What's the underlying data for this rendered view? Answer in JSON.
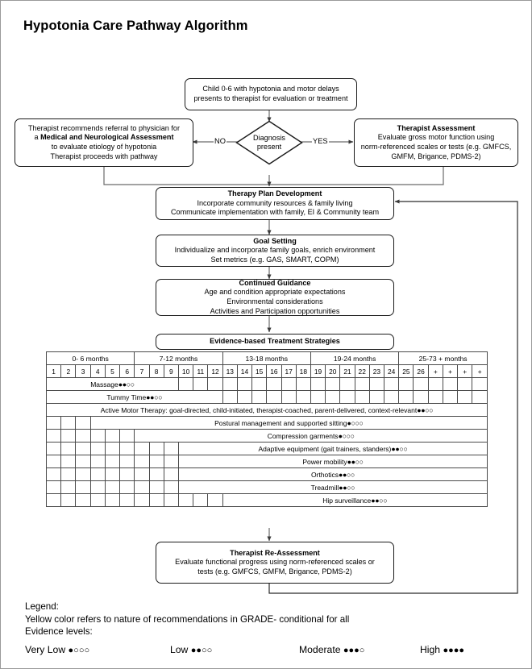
{
  "page": {
    "title": "Hypotonia Care Pathway Algorithm"
  },
  "flow": {
    "start": {
      "name": "start-box",
      "lines": [
        "Child 0-6 with hypotonia and motor delays",
        "presents to therapist for evaluation or treatment"
      ]
    },
    "decision": {
      "name": "decision-diamond",
      "lines": [
        "Diagnosis",
        "present"
      ],
      "no_label": "NO",
      "yes_label": "YES"
    },
    "left_box": {
      "name": "referral-box",
      "line1": "Therapist recommends referral to physician for",
      "line2_pre": "a ",
      "line2_bold": "Medical and Neurological Assessment",
      "line3": "to evaluate etiology of hypotonia",
      "line4": "Therapist proceeds with pathway"
    },
    "right_box": {
      "name": "therapist-assessment-box",
      "heading": "Therapist Assessment",
      "lines": [
        "Evaluate gross motor function using",
        "norm-referenced scales or tests (e.g. GMFCS,",
        "GMFM, Brigance, PDMS-2)"
      ]
    },
    "plan": {
      "name": "therapy-plan-box",
      "heading": "Therapy Plan Development",
      "lines": [
        "Incorporate community resources & family living",
        "Communicate implementation with family, EI & Community team"
      ]
    },
    "goals": {
      "name": "goal-setting-box",
      "heading": "Goal Setting",
      "lines": [
        "Individualize and incorporate family goals, enrich environment",
        "Set metrics (e.g. GAS, SMART, COPM)"
      ]
    },
    "guidance": {
      "name": "continued-guidance-box",
      "heading": "Continued Guidance",
      "lines": [
        "Age and condition appropriate expectations",
        "Environmental considerations",
        "Activities and Participation opportunities"
      ]
    },
    "strategies": {
      "name": "evidence-strategies-box",
      "heading": "Evidence-based Treatment Strategies"
    },
    "reassessment": {
      "name": "therapist-reassessment-box",
      "heading": "Therapist Re-Assessment",
      "lines": [
        "Evaluate functional progress using norm-referenced scales or",
        "tests (e.g. GMFCS, GMFM, Brigance, PDMS-2)"
      ]
    }
  },
  "chart_data": {
    "type": "table",
    "title": "Evidence-based Treatment Strategies timeline",
    "age_groups": [
      {
        "label": "0- 6 months",
        "span": 6
      },
      {
        "label": "7-12 months",
        "span": 6
      },
      {
        "label": "13-18 months",
        "span": 6
      },
      {
        "label": "19-24 months",
        "span": 6
      },
      {
        "label": "25-73 + months",
        "span": 6
      }
    ],
    "month_labels": [
      "1",
      "2",
      "3",
      "4",
      "5",
      "6",
      "7",
      "8",
      "9",
      "10",
      "11",
      "12",
      "13",
      "14",
      "15",
      "16",
      "17",
      "18",
      "19",
      "20",
      "21",
      "22",
      "23",
      "24",
      "25",
      "26",
      "+",
      "+",
      "+",
      "+"
    ],
    "columns": 30,
    "interventions": [
      {
        "label": "Massage",
        "dots": "●●○○",
        "grade": "low",
        "start": 1,
        "end": 9
      },
      {
        "label": "Tummy Time",
        "dots": "●●○○",
        "grade": "low",
        "start": 1,
        "end": 12
      },
      {
        "label": "Active Motor Therapy: goal-directed, child-initiated, therapist-coached, parent-delivered, context-relevant",
        "dots": "●●○○",
        "grade": "low",
        "start": 1,
        "end": 30
      },
      {
        "label": "Postural management and supported sitting ",
        "dots": "●○○○",
        "grade": "very low",
        "start": 4,
        "end": 30
      },
      {
        "label": "Compression garments",
        "dots": "●○○○",
        "grade": "very low",
        "start": 7,
        "end": 30
      },
      {
        "label": "Adaptive equipment (gait trainers, standers)",
        "dots": "●●○○",
        "grade": "low",
        "start": 10,
        "end": 30
      },
      {
        "label": "Power mobility",
        "dots": "●●○○",
        "grade": "low",
        "start": 10,
        "end": 30
      },
      {
        "label": "Orthotics ",
        "dots": "●●○○",
        "grade": "low",
        "start": 10,
        "end": 30
      },
      {
        "label": "Treadmill ",
        "dots": "●●○○",
        "grade": "low",
        "start": 10,
        "end": 30
      },
      {
        "label": "Hip surveillance",
        "dots": "●●○○",
        "grade": "low",
        "start": 13,
        "end": 30
      }
    ],
    "colors": {
      "bar": "#fcdc76",
      "header": "#c6c6c6",
      "grid": "#4a4a4a"
    }
  },
  "legend": {
    "heading": "Legend:",
    "line2": "Yellow color refers to nature of recommendations in GRADE- conditional for all",
    "line3": "Evidence levels:",
    "scale": [
      {
        "label": "Very Low",
        "dots": "●○○○"
      },
      {
        "label": "Low",
        "dots": "●●○○"
      },
      {
        "label": "Moderate",
        "dots": "●●●○"
      },
      {
        "label": "High",
        "dots": "●●●●"
      }
    ]
  }
}
